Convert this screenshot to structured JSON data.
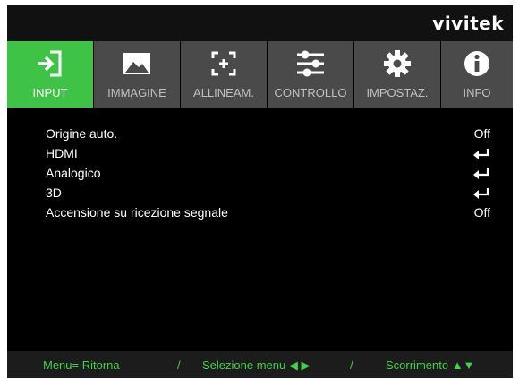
{
  "brand": "vivitek",
  "tabs": [
    {
      "label": "INPUT",
      "icon": "input-icon",
      "selected": true
    },
    {
      "label": "IMMAGINE",
      "icon": "image-icon",
      "selected": false
    },
    {
      "label": "ALLINEAM.",
      "icon": "alignment-icon",
      "selected": false
    },
    {
      "label": "CONTROLLO",
      "icon": "sliders-icon",
      "selected": false
    },
    {
      "label": "IMPOSTAZ.",
      "icon": "gear-icon",
      "selected": false
    },
    {
      "label": "INFO",
      "icon": "info-icon",
      "selected": false
    }
  ],
  "menu": {
    "items": [
      {
        "label": "Origine auto.",
        "value": "Off"
      },
      {
        "label": "HDMI",
        "value_icon": "enter-icon"
      },
      {
        "label": "Analogico",
        "value_icon": "enter-icon"
      },
      {
        "label": "3D",
        "value_icon": "enter-icon"
      },
      {
        "label": "Accensione su ricezione segnale",
        "value": "Off"
      }
    ]
  },
  "footer": {
    "return": "Menu= Ritorna",
    "sep1": "/",
    "select": "Selezione menu ◀ ▶",
    "sep2": "/",
    "scroll": "Scorrimento ▲▼"
  },
  "colors": {
    "selected_tab": "#3ec346",
    "tab_bg": "#4a4a4a",
    "footer_text": "#3fd24a",
    "background": "#000000"
  }
}
